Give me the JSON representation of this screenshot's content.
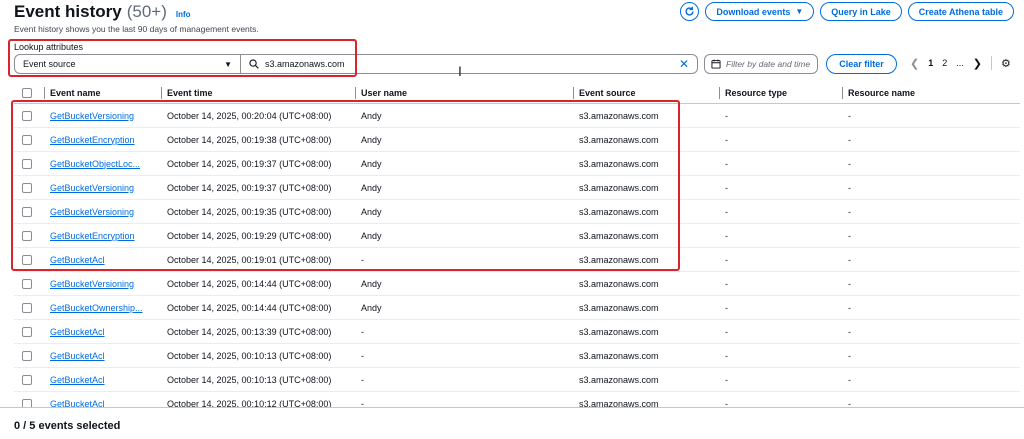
{
  "header": {
    "title": "Event history",
    "count": "(50+)",
    "info": "Info",
    "subtitle": "Event history shows you the last 90 days of management events."
  },
  "actions": {
    "refresh_icon": "refresh-icon",
    "download": "Download events",
    "query": "Query in Lake",
    "athena": "Create Athena table"
  },
  "lookup": {
    "label": "Lookup attributes",
    "attribute": "Event source",
    "value": "s3.amazonaws.com"
  },
  "filter": {
    "date_placeholder": "Filter by date and time",
    "clear": "Clear filter"
  },
  "pagination": {
    "page1": "1",
    "page2": "2",
    "ellipsis": "..."
  },
  "columns": [
    "Event name",
    "Event time",
    "User name",
    "Event source",
    "Resource type",
    "Resource name"
  ],
  "rows": [
    {
      "name": "GetBucketVersioning",
      "time": "October 14, 2025, 00:20:04 (UTC+08:00)",
      "user": "Andy",
      "source": "s3.amazonaws.com",
      "rtype": "-",
      "rname": "-"
    },
    {
      "name": "GetBucketEncryption",
      "time": "October 14, 2025, 00:19:38 (UTC+08:00)",
      "user": "Andy",
      "source": "s3.amazonaws.com",
      "rtype": "-",
      "rname": "-"
    },
    {
      "name": "GetBucketObjectLoc...",
      "time": "October 14, 2025, 00:19:37 (UTC+08:00)",
      "user": "Andy",
      "source": "s3.amazonaws.com",
      "rtype": "-",
      "rname": "-"
    },
    {
      "name": "GetBucketVersioning",
      "time": "October 14, 2025, 00:19:37 (UTC+08:00)",
      "user": "Andy",
      "source": "s3.amazonaws.com",
      "rtype": "-",
      "rname": "-"
    },
    {
      "name": "GetBucketVersioning",
      "time": "October 14, 2025, 00:19:35 (UTC+08:00)",
      "user": "Andy",
      "source": "s3.amazonaws.com",
      "rtype": "-",
      "rname": "-"
    },
    {
      "name": "GetBucketEncryption",
      "time": "October 14, 2025, 00:19:29 (UTC+08:00)",
      "user": "Andy",
      "source": "s3.amazonaws.com",
      "rtype": "-",
      "rname": "-"
    },
    {
      "name": "GetBucketAcl",
      "time": "October 14, 2025, 00:19:01 (UTC+08:00)",
      "user": "-",
      "source": "s3.amazonaws.com",
      "rtype": "-",
      "rname": "-"
    },
    {
      "name": "GetBucketVersioning",
      "time": "October 14, 2025, 00:14:44 (UTC+08:00)",
      "user": "Andy",
      "source": "s3.amazonaws.com",
      "rtype": "-",
      "rname": "-"
    },
    {
      "name": "GetBucketOwnership...",
      "time": "October 14, 2025, 00:14:44 (UTC+08:00)",
      "user": "Andy",
      "source": "s3.amazonaws.com",
      "rtype": "-",
      "rname": "-"
    },
    {
      "name": "GetBucketAcl",
      "time": "October 14, 2025, 00:13:39 (UTC+08:00)",
      "user": "-",
      "source": "s3.amazonaws.com",
      "rtype": "-",
      "rname": "-"
    },
    {
      "name": "GetBucketAcl",
      "time": "October 14, 2025, 00:10:13 (UTC+08:00)",
      "user": "-",
      "source": "s3.amazonaws.com",
      "rtype": "-",
      "rname": "-"
    },
    {
      "name": "GetBucketAcl",
      "time": "October 14, 2025, 00:10:13 (UTC+08:00)",
      "user": "-",
      "source": "s3.amazonaws.com",
      "rtype": "-",
      "rname": "-"
    },
    {
      "name": "GetBucketAcl",
      "time": "October 14, 2025, 00:10:12 (UTC+08:00)",
      "user": "-",
      "source": "s3.amazonaws.com",
      "rtype": "-",
      "rname": "-"
    }
  ],
  "footer": {
    "selected": "0 / 5 events selected"
  },
  "colors": {
    "accent": "#006ce0",
    "highlight": "#d9232d"
  }
}
